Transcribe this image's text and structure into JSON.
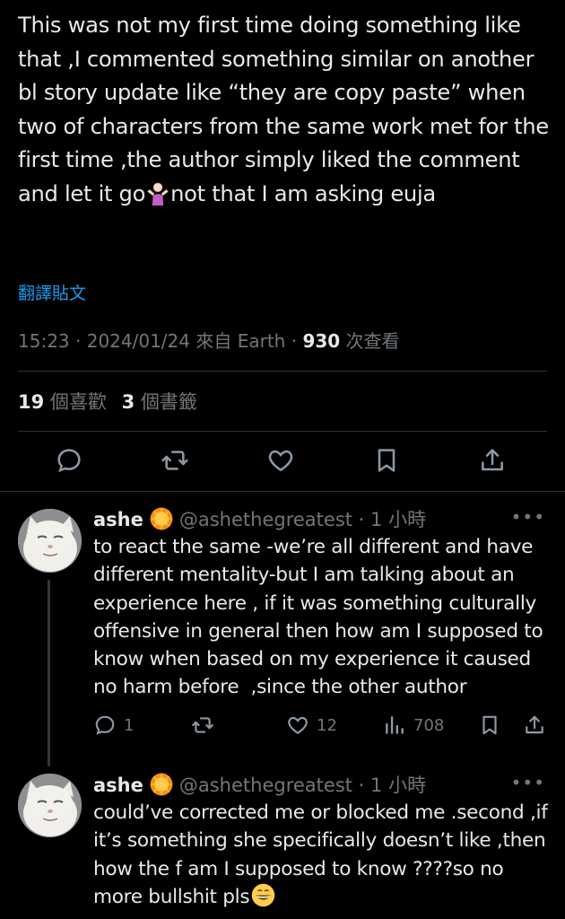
{
  "tweet": {
    "text_before_emoji": "This was not my first time doing something like that ,I commented something similar on another bl story update like “they are copy paste” when two of characters from the same work met for the first time ,the author simply liked the comment and let it go",
    "text_after_emoji": "not that I am asking euja",
    "emoji_icon": "person-shrugging-emoji",
    "translate_label": "翻譯貼文",
    "time": "15:23",
    "date": "2024/01/24",
    "source": "來自 Earth",
    "views_count": "930",
    "views_label": "次查看",
    "likes_count": "19",
    "likes_label": "個喜歡",
    "bookmarks_count": "3",
    "bookmarks_label": "個書籤"
  },
  "actions": [
    "reply-icon",
    "retweet-icon",
    "like-icon",
    "bookmark-icon",
    "share-icon"
  ],
  "replies": [
    {
      "name": "ashe",
      "badge_icon": "sun-emoji",
      "handle": "@ashethegreatest",
      "time": "1 小時",
      "text": "to react the same -we’re all different and have different mentality-but I am talking about an experience here , if it was something culturally offensive in general then how am I supposed to know when based on my experience it caused no harm before  ,since the other author",
      "reply_count": "1",
      "like_count": "12",
      "view_count": "708"
    },
    {
      "name": "ashe",
      "badge_icon": "sun-emoji",
      "handle": "@ashethegreatest",
      "time": "1 小時",
      "text_before_emoji": "could’ve corrected me or blocked me .second ,if it’s something she specifically doesn’t like ,then how the f am I supposed to know ????so no more bullshit pls",
      "trailing_emoji": "grinning-face-emoji"
    }
  ],
  "colors": {
    "background": "#000000",
    "text": "#e7e9ea",
    "muted": "#71767b",
    "accent": "#1d9bf0",
    "divider": "#2f3336"
  }
}
